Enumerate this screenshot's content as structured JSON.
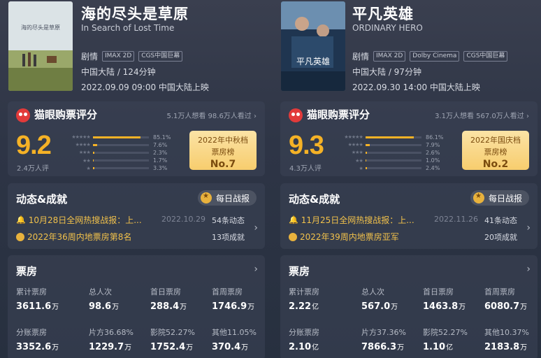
{
  "movies": [
    {
      "title_cn": "海的尽头是草原",
      "title_en": "In Search of Lost Time",
      "genre": "剧情",
      "tags": [
        "IMAX 2D",
        "CGS中国巨幕"
      ],
      "region_runtime": "中国大陆 / 124分钟",
      "release": "2022.09.09 09:00 中国大陆上映",
      "rating_title": "猫眼购票评分",
      "want_seen": "5.1万人想看 98.6万人看过",
      "score": "9.2",
      "score_count": "2.4万人评",
      "star_dist": [
        {
          "stars": "★★★★★",
          "pct": "85.1%",
          "value": 85.1
        },
        {
          "stars": "★★★★",
          "pct": "7.6%",
          "value": 7.6
        },
        {
          "stars": "★★★",
          "pct": "2.3%",
          "value": 2.3
        },
        {
          "stars": "★★",
          "pct": "1.7%",
          "value": 1.7
        },
        {
          "stars": "★",
          "pct": "3.3%",
          "value": 3.3
        }
      ],
      "award_line1": "2022年中秋档",
      "award_line2": "票房榜",
      "award_rank": "No.7",
      "dyn_title": "动态&成就",
      "daily_label": "每日战报",
      "dyn_row1": "10月28日全网热搜战报：上...",
      "dyn_date": "2022.10.29",
      "dyn_row2": "2022年36周内地票房第8名",
      "dyn_side1": "54条动态",
      "dyn_side2": "13项成就",
      "bo_title": "票房",
      "bo_row1": [
        {
          "label": "累计票房",
          "value": "3611.6",
          "unit": "万"
        },
        {
          "label": "总人次",
          "value": "98.6",
          "unit": "万"
        },
        {
          "label": "首日票房",
          "value": "288.4",
          "unit": "万"
        },
        {
          "label": "首周票房",
          "value": "1746.9",
          "unit": "万"
        }
      ],
      "bo_row2": [
        {
          "label": "分账票房",
          "value": "3352.6",
          "unit": "万"
        },
        {
          "label": "片方36.68%",
          "value": "1229.7",
          "unit": "万"
        },
        {
          "label": "影院52.27%",
          "value": "1752.4",
          "unit": "万"
        },
        {
          "label": "其他11.05%",
          "value": "370.4",
          "unit": "万"
        }
      ]
    },
    {
      "title_cn": "平凡英雄",
      "title_en": "ORDINARY HERO",
      "genre": "剧情",
      "tags": [
        "IMAX 2D",
        "Dolby Cinema",
        "CGS中国巨幕"
      ],
      "region_runtime": "中国大陆 / 97分钟",
      "release": "2022.09.30 14:00 中国大陆上映",
      "rating_title": "猫眼购票评分",
      "want_seen": "3.1万人想看 567.0万人看过",
      "score": "9.3",
      "score_count": "4.3万人评",
      "star_dist": [
        {
          "stars": "★★★★★",
          "pct": "86.1%",
          "value": 86.1
        },
        {
          "stars": "★★★★",
          "pct": "7.9%",
          "value": 7.9
        },
        {
          "stars": "★★★",
          "pct": "2.6%",
          "value": 2.6
        },
        {
          "stars": "★★",
          "pct": "1.0%",
          "value": 1.0
        },
        {
          "stars": "★",
          "pct": "2.4%",
          "value": 2.4
        }
      ],
      "award_line1": "2022年国庆档",
      "award_line2": "票房榜",
      "award_rank": "No.2",
      "dyn_title": "动态&成就",
      "daily_label": "每日战报",
      "dyn_row1": "11月25日全网热搜战报：上...",
      "dyn_date": "2022.11.26",
      "dyn_row2": "2022年39周内地票房亚军",
      "dyn_side1": "41条动态",
      "dyn_side2": "20项成就",
      "bo_title": "票房",
      "bo_row1": [
        {
          "label": "累计票房",
          "value": "2.22",
          "unit": "亿"
        },
        {
          "label": "总人次",
          "value": "567.0",
          "unit": "万"
        },
        {
          "label": "首日票房",
          "value": "1463.8",
          "unit": "万"
        },
        {
          "label": "首周票房",
          "value": "6080.7",
          "unit": "万"
        }
      ],
      "bo_row2": [
        {
          "label": "分账票房",
          "value": "2.10",
          "unit": "亿"
        },
        {
          "label": "片方37.36%",
          "value": "7866.3",
          "unit": "万"
        },
        {
          "label": "影院52.27%",
          "value": "1.10",
          "unit": "亿"
        },
        {
          "label": "其他10.37%",
          "value": "2183.8",
          "unit": "万"
        }
      ]
    }
  ],
  "colors": {
    "score": "#f5b226",
    "background": "#2b3344",
    "achievement": "#f1c14b"
  }
}
